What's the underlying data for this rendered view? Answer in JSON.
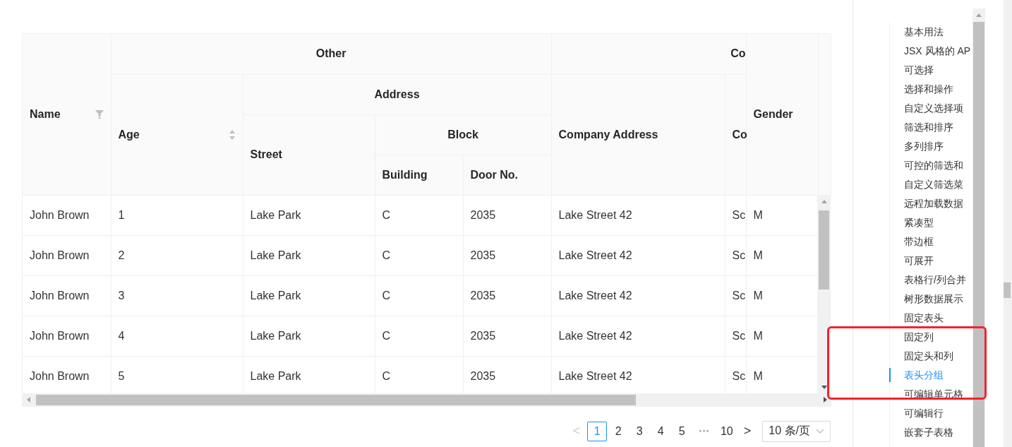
{
  "table": {
    "header": {
      "name": "Name",
      "other": "Other",
      "age": "Age",
      "address": "Address",
      "street": "Street",
      "block": "Block",
      "building": "Building",
      "door_no": "Door No.",
      "company_group": "Co",
      "company_address": "Company Address",
      "company_name": "Co",
      "gender": "Gender"
    },
    "rows": [
      {
        "name": "John Brown",
        "age": "1",
        "street": "Lake Park",
        "building": "C",
        "door_no": "2035",
        "company_address": "Lake Street 42",
        "company_name": "Sc",
        "gender": "M"
      },
      {
        "name": "John Brown",
        "age": "2",
        "street": "Lake Park",
        "building": "C",
        "door_no": "2035",
        "company_address": "Lake Street 42",
        "company_name": "Sc",
        "gender": "M"
      },
      {
        "name": "John Brown",
        "age": "3",
        "street": "Lake Park",
        "building": "C",
        "door_no": "2035",
        "company_address": "Lake Street 42",
        "company_name": "Sc",
        "gender": "M"
      },
      {
        "name": "John Brown",
        "age": "4",
        "street": "Lake Park",
        "building": "C",
        "door_no": "2035",
        "company_address": "Lake Street 42",
        "company_name": "Sc",
        "gender": "M"
      },
      {
        "name": "John Brown",
        "age": "5",
        "street": "Lake Park",
        "building": "C",
        "door_no": "2035",
        "company_address": "Lake Street 42",
        "company_name": "Sc",
        "gender": "M"
      }
    ]
  },
  "pagination": {
    "prev": "<",
    "pages": [
      {
        "label": "1",
        "selected": true
      },
      {
        "label": "2",
        "selected": false
      },
      {
        "label": "3",
        "selected": false
      },
      {
        "label": "4",
        "selected": false
      },
      {
        "label": "5",
        "selected": false
      },
      {
        "label": "•••",
        "kind": "ellipsis",
        "selected": false
      },
      {
        "label": "10",
        "selected": false
      }
    ],
    "next": ">",
    "page_size": "10 条/页"
  },
  "nav": {
    "items": [
      {
        "label": "基本用法",
        "selected": false
      },
      {
        "label": "JSX 风格的 AP",
        "selected": false
      },
      {
        "label": "可选择",
        "selected": false
      },
      {
        "label": "选择和操作",
        "selected": false
      },
      {
        "label": "自定义选择项",
        "selected": false
      },
      {
        "label": "筛选和排序",
        "selected": false
      },
      {
        "label": "多列排序",
        "selected": false
      },
      {
        "label": "可控的筛选和",
        "selected": false
      },
      {
        "label": "自定义筛选菜",
        "selected": false
      },
      {
        "label": "远程加载数据",
        "selected": false
      },
      {
        "label": "紧凑型",
        "selected": false
      },
      {
        "label": "带边框",
        "selected": false
      },
      {
        "label": "可展开",
        "selected": false
      },
      {
        "label": "表格行/列合并",
        "selected": false
      },
      {
        "label": "树形数据展示",
        "selected": false
      },
      {
        "label": "固定表头",
        "selected": false
      },
      {
        "label": "固定列",
        "selected": false
      },
      {
        "label": "固定头和列",
        "selected": false
      },
      {
        "label": "表头分组",
        "selected": true
      },
      {
        "label": "可编辑单元格",
        "selected": false
      },
      {
        "label": "可编辑行",
        "selected": false
      },
      {
        "label": "嵌套子表格",
        "selected": false
      }
    ]
  }
}
